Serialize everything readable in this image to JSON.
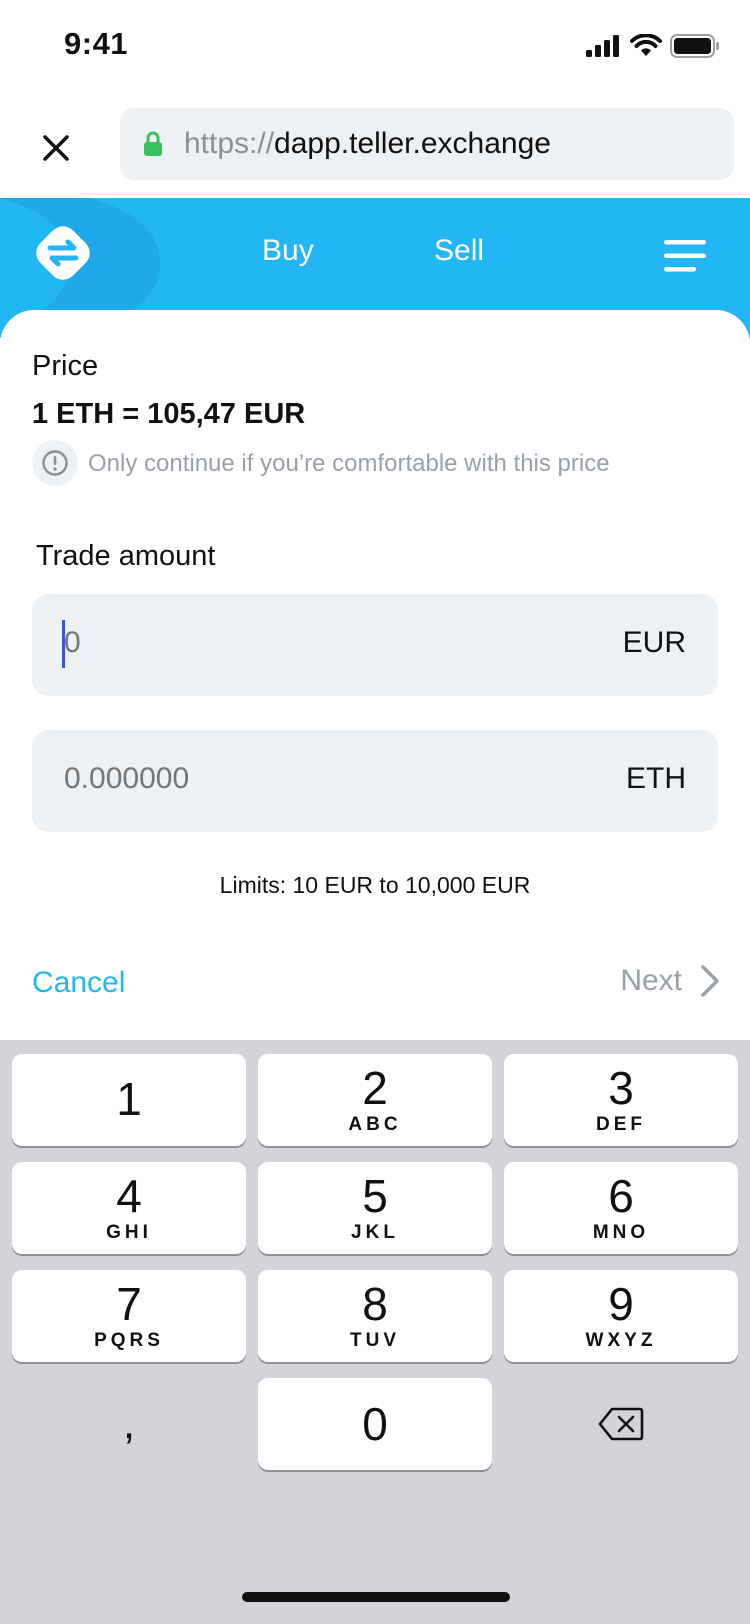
{
  "status_bar": {
    "time": "9:41"
  },
  "browser": {
    "url_scheme": "https://",
    "url_host": "dapp.teller.exchange"
  },
  "header": {
    "nav_buy": "Buy",
    "nav_sell": "Sell",
    "brand_color": "#22b6f5"
  },
  "price": {
    "label": "Price",
    "value": "1 ETH = 105,47 EUR",
    "warning": "Only continue if you’re comfortable with this price"
  },
  "trade": {
    "label": "Trade amount",
    "eur_placeholder": "0",
    "eur_currency": "EUR",
    "eth_placeholder": "0.000000",
    "eth_currency": "ETH",
    "limits": "Limits: 10 EUR to 10,000 EUR"
  },
  "actions": {
    "cancel": "Cancel",
    "next": "Next"
  },
  "keyboard": {
    "keys": [
      {
        "digit": "1",
        "letters": ""
      },
      {
        "digit": "2",
        "letters": "ABC"
      },
      {
        "digit": "3",
        "letters": "DEF"
      },
      {
        "digit": "4",
        "letters": "GHI"
      },
      {
        "digit": "5",
        "letters": "JKL"
      },
      {
        "digit": "6",
        "letters": "MNO"
      },
      {
        "digit": "7",
        "letters": "PQRS"
      },
      {
        "digit": "8",
        "letters": "TUV"
      },
      {
        "digit": "9",
        "letters": "WXYZ"
      },
      {
        "digit": "0",
        "letters": ""
      }
    ],
    "comma": ",",
    "delete_icon": "backspace-icon"
  }
}
